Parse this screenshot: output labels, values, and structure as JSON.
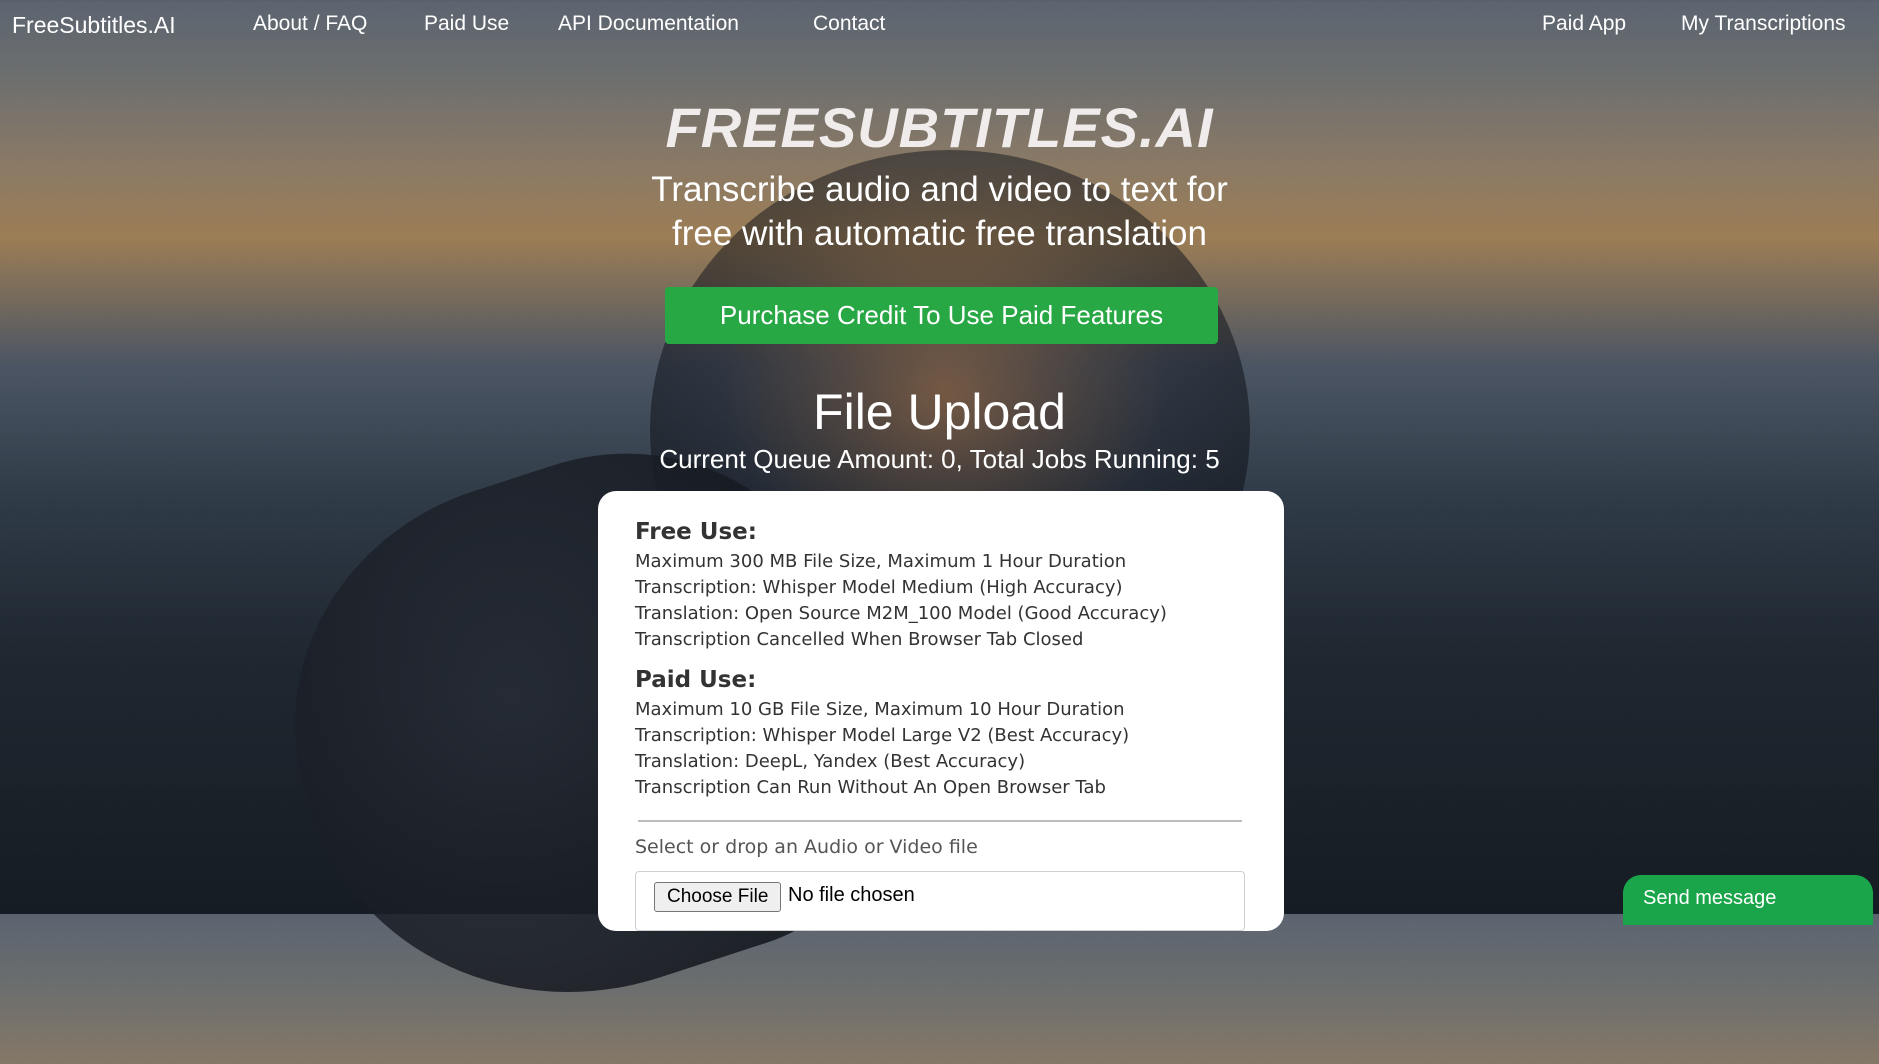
{
  "nav": {
    "brand": "FreeSubtitles.AI",
    "links": [
      "About / FAQ",
      "Paid Use",
      "API Documentation",
      "Contact"
    ],
    "right_links": [
      "Paid App",
      "My Transcriptions"
    ]
  },
  "hero": {
    "title": "FREESUBTITLES.AI",
    "subtitle_line1": "Transcribe audio and video to text for",
    "subtitle_line2": "free with automatic free translation",
    "purchase_button": "Purchase Credit To Use Paid Features"
  },
  "upload": {
    "title": "File Upload",
    "queue_status": "Current Queue Amount: 0, Total Jobs Running: 5"
  },
  "card": {
    "free_title": "Free Use:",
    "free_lines": [
      "Maximum 300 MB File Size, Maximum 1 Hour Duration",
      "Transcription: Whisper Model Medium (High Accuracy)",
      "Translation: Open Source M2M_100 Model (Good Accuracy)",
      "Transcription Cancelled When Browser Tab Closed"
    ],
    "paid_title": "Paid Use:",
    "paid_lines": [
      "Maximum 10 GB File Size, Maximum 10 Hour Duration",
      "Transcription: Whisper Model Large V2 (Best Accuracy)",
      "Translation: DeepL, Yandex (Best Accuracy)",
      "Transcription Can Run Without An Open Browser Tab"
    ],
    "drop_label": "Select or drop an Audio or Video file",
    "choose_file": "Choose File",
    "no_file": "No file chosen"
  },
  "chat": {
    "send_message": "Send message"
  },
  "colors": {
    "accent_green": "#28a745",
    "chat_green": "#1aa54a"
  }
}
